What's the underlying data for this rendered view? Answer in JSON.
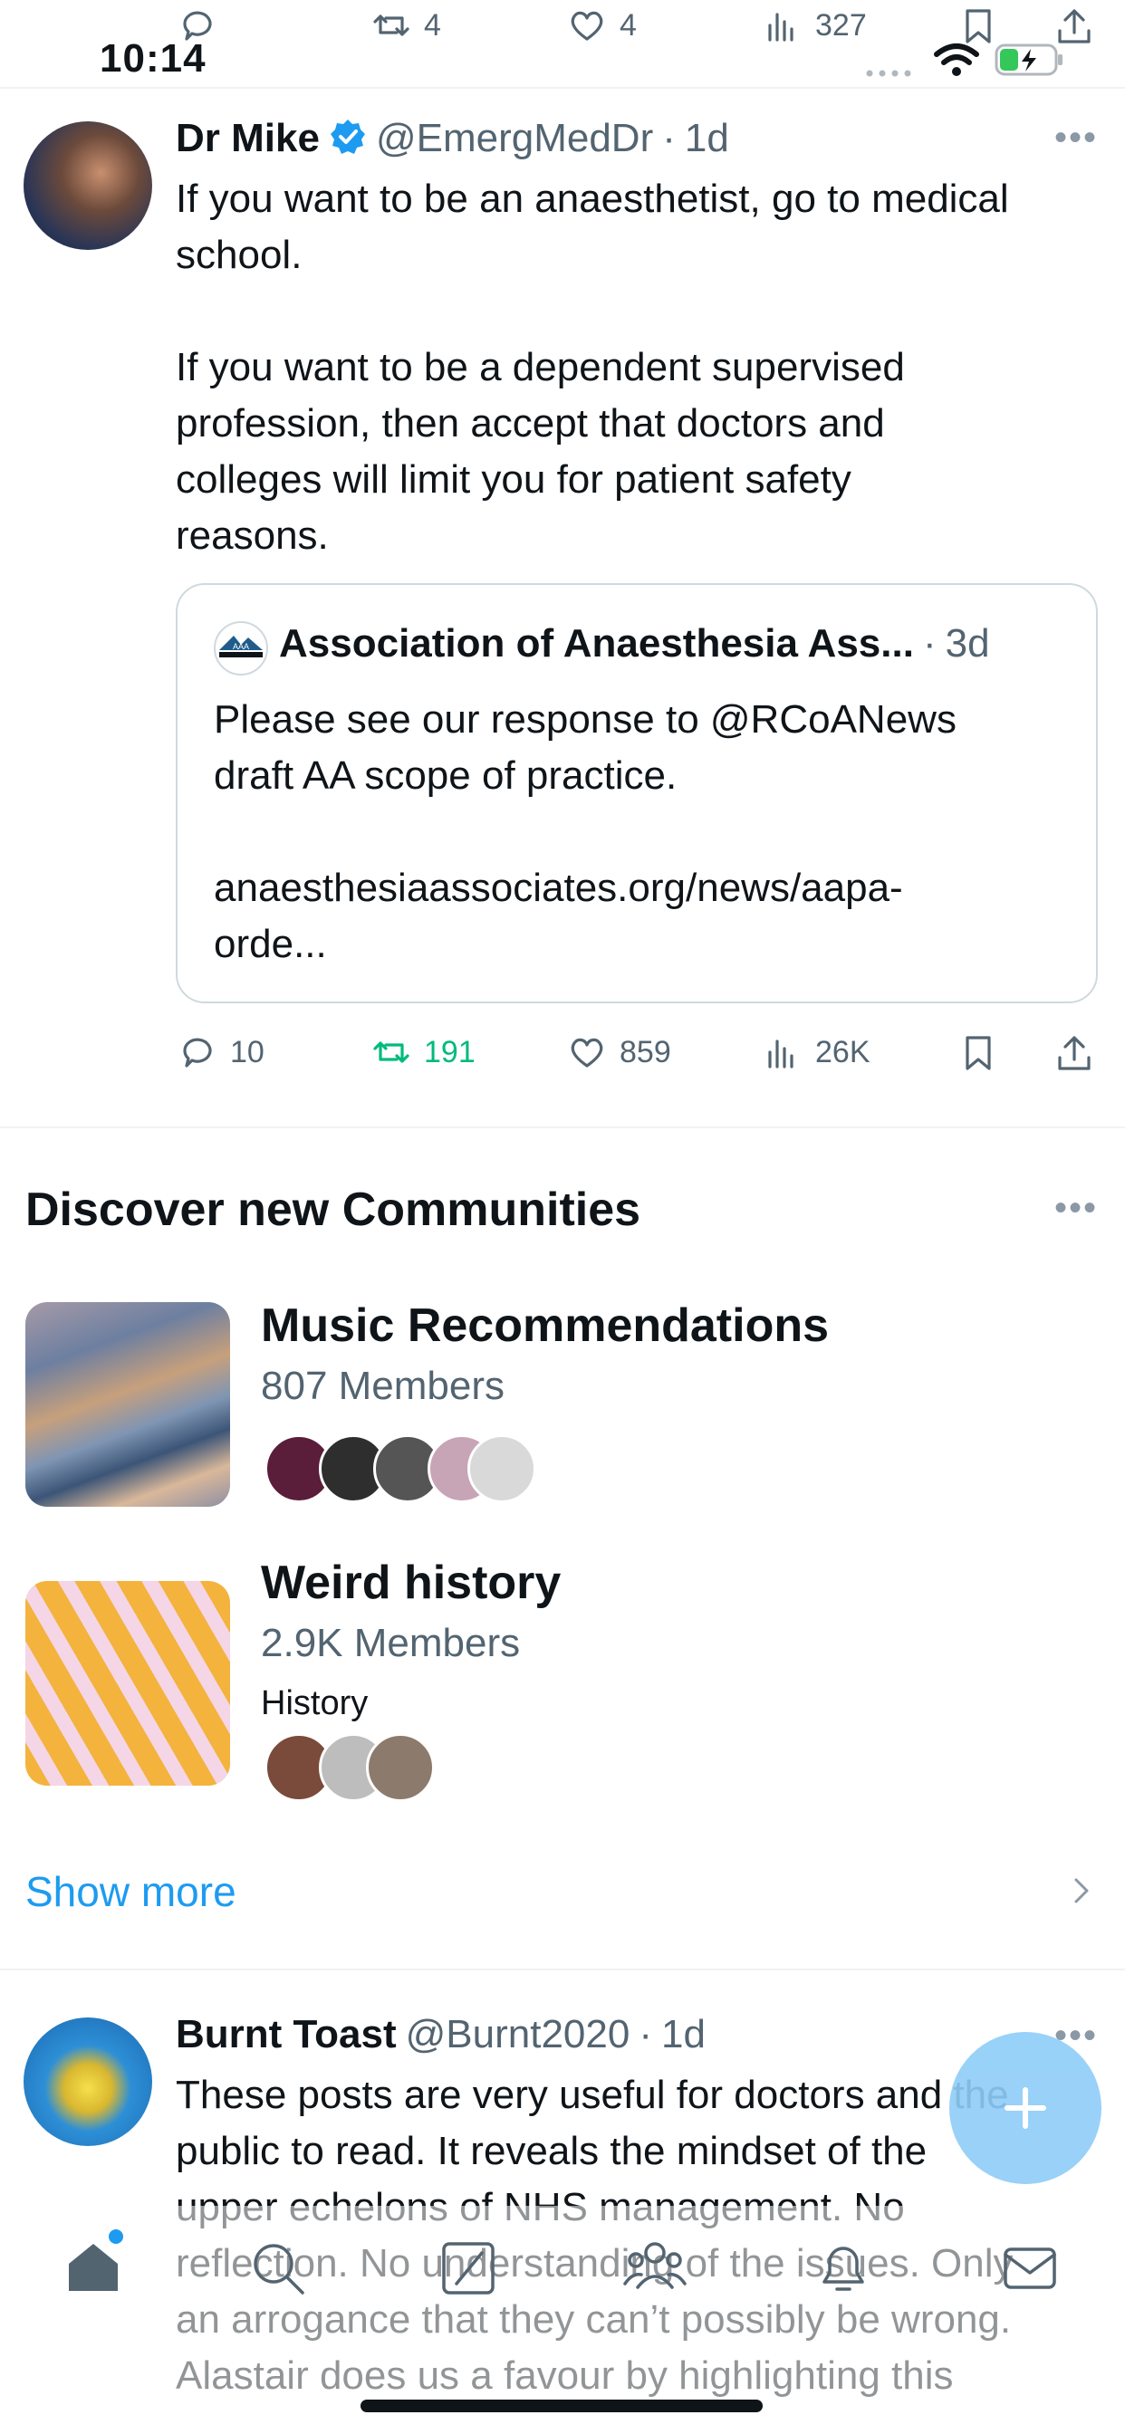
{
  "status_bar": {
    "time": "10:14"
  },
  "previous_tweet_actions": {
    "retweets": "4",
    "likes": "4",
    "views": "327"
  },
  "tweet": {
    "name": "Dr Mike",
    "handle": "@EmergMedDr",
    "time": "1d",
    "text": "If you want to be an anaesthetist, go to medical\nschool.\n\nIf you want to be a dependent supervised\nprofession, then accept that doctors and\ncolleges will limit you for patient safety\nreasons.",
    "quote": {
      "name": "Association of Anaesthesia Ass...",
      "time": "3d",
      "text": "Please see our response to @RCoANews\ndraft AA scope of practice.\n\nanaesthesiaassociates.org/news/aapa-\norde..."
    },
    "actions": {
      "replies": "10",
      "retweets": "191",
      "likes": "859",
      "views": "26K"
    },
    "colors": {
      "retweeted": "#00ba7c",
      "verified": "#1d9bf0"
    }
  },
  "communities": {
    "title": "Discover new Communities",
    "items": [
      {
        "name": "Music Recommendations",
        "members": "807 Members",
        "category": ""
      },
      {
        "name": "Weird history",
        "members": "2.9K Members",
        "category": "History"
      }
    ],
    "show_more": "Show more"
  },
  "reply_tweet": {
    "name": "Burnt Toast",
    "handle": "@Burnt2020",
    "time": "1d",
    "text": "These posts are very useful for doctors and the\npublic to read. It reveals the mindset of the\nupper echelons of NHS management. No\nreflection. No understanding of the issues. Only\nan arrogance that they can’t possibly be wrong.\nAlastair does us a favour by highlighting this"
  },
  "bottom_nav": {
    "items": [
      "home-icon",
      "search-icon",
      "grok-icon",
      "communities-icon",
      "notifications-icon",
      "messages-icon"
    ]
  },
  "accent": "#1d9bf0"
}
